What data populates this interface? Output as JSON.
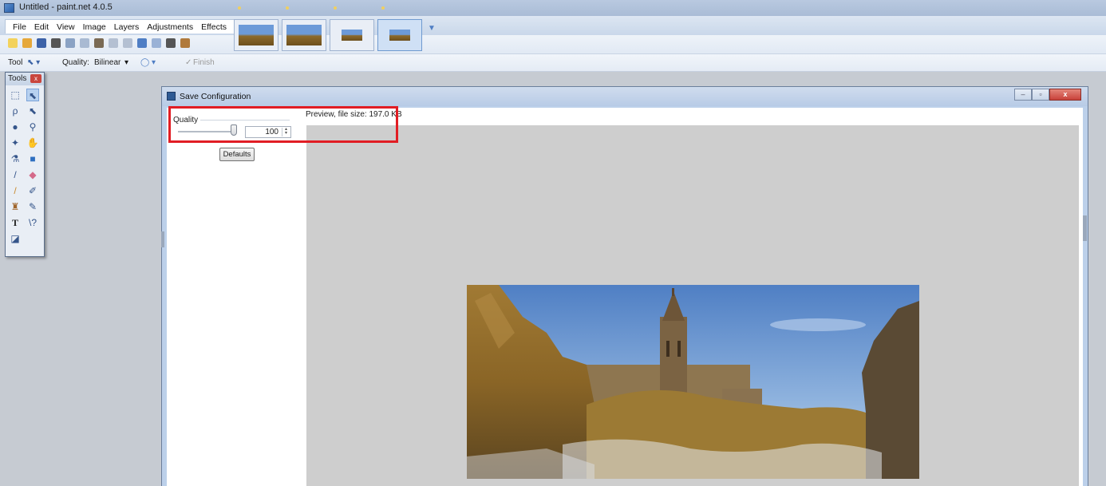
{
  "app": {
    "title": "Untitled - paint.net 4.0.5"
  },
  "menu": [
    "File",
    "Edit",
    "View",
    "Image",
    "Layers",
    "Adjustments",
    "Effects"
  ],
  "toolbar2": {
    "tool_label": "Tool",
    "quality_label": "Quality:",
    "quality_value": "Bilinear",
    "finish_label": "Finish"
  },
  "tools_panel": {
    "title": "Tools",
    "close": "x"
  },
  "dialog": {
    "title": "Save Configuration",
    "quality_label": "Quality",
    "quality_value": "100",
    "quality_fraction": 1.0,
    "defaults_label": "Defaults",
    "preview_label": "Preview, file size: 197.0 KB",
    "close_glyph": "x",
    "min_glyph": "–",
    "max_glyph": "▫"
  },
  "colors": {
    "highlight": "#e11d24",
    "titlebar": "#b9c9e0",
    "preview_bg": "#cecece"
  }
}
